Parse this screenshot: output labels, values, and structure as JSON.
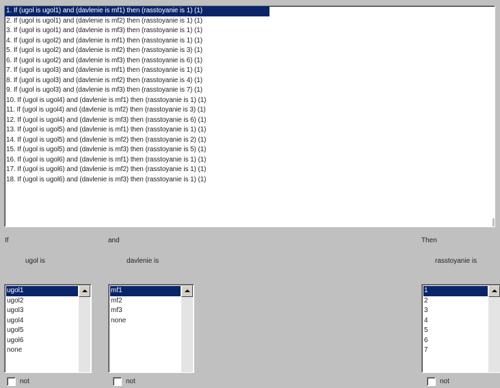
{
  "rules": [
    "1. If (ugol is ugol1) and (davlenie is mf1) then (rasstoyanie is 1) (1)",
    "2. If (ugol is ugol1) and (davlenie is mf2) then (rasstoyanie is 1) (1)",
    "3. If (ugol is ugol1) and (davlenie is mf3) then (rasstoyanie is 1) (1)",
    "4. If (ugol is ugol2) and (davlenie is mf1) then (rasstoyanie is 1) (1)",
    "5. If (ugol is ugol2) and (davlenie is mf2) then (rasstoyanie is 3) (1)",
    "6. If (ugol is ugol2) and (davlenie is mf3) then (rasstoyanie is 6) (1)",
    "7. If (ugol is ugol3) and (davlenie is mf1) then (rasstoyanie is 1) (1)",
    "8. If (ugol is ugol3) and (davlenie is mf2) then (rasstoyanie is 4) (1)",
    "9. If (ugol is ugol3) and (davlenie is mf3) then (rasstoyanie is 7) (1)",
    "10. If (ugol is ugol4) and (davlenie is mf1) then (rasstoyanie is 1) (1)",
    "11. If (ugol is ugol4) and (davlenie is mf2) then (rasstoyanie is 3) (1)",
    "12. If (ugol is ugol4) and (davlenie is mf3) then (rasstoyanie is 6) (1)",
    "13. If (ugol is ugol5) and (davlenie is mf1) then (rasstoyanie is 1) (1)",
    "14. If (ugol is ugol5) and (davlenie is mf2) then (rasstoyanie is 2) (1)",
    "15. If (ugol is ugol5) and (davlenie is mf3) then (rasstoyanie is 5) (1)",
    "16. If (ugol is ugol6) and (davlenie is mf1) then (rasstoyanie is 1) (1)",
    "17. If (ugol is ugol6) and (davlenie is mf2) then (rasstoyanie is 1) (1)",
    "18. If (ugol is ugol6) and (davlenie is mf3) then (rasstoyanie is 1) (1)"
  ],
  "selected_rule_index": 0,
  "labels": {
    "if": "If",
    "and": "and",
    "then": "Then",
    "ugol_is": "ugol is",
    "davlenie_is": "davlenie is",
    "rasstoyanie_is": "rasstoyanie is"
  },
  "ugol_options": [
    "ugol1",
    "ugol2",
    "ugol3",
    "ugol4",
    "ugol5",
    "ugol6",
    "none"
  ],
  "davlenie_options": [
    "mf1",
    "mf2",
    "mf3",
    "none"
  ],
  "rasstoyanie_options": [
    "1",
    "2",
    "3",
    "4",
    "5",
    "6",
    "7"
  ],
  "selected": {
    "ugol": "ugol1",
    "davlenie": "mf1",
    "rasstoyanie": "1"
  },
  "not_label": "not",
  "colors": {
    "selection": "#0a246a",
    "panel": "#c0c0c0"
  }
}
